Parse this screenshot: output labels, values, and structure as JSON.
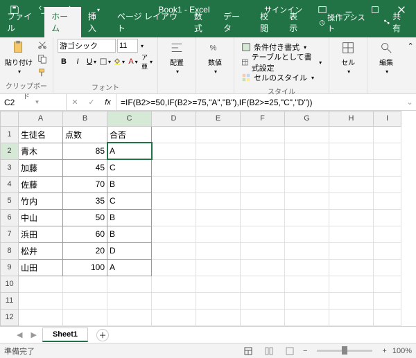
{
  "title": "Book1 - Excel",
  "signin": "サインイン",
  "tabs": {
    "file": "ファイル",
    "home": "ホーム",
    "insert": "挿入",
    "layout": "ページ レイアウト",
    "formulas": "数式",
    "data": "データ",
    "review": "校閲",
    "view": "表示",
    "tell": "操作アシスト",
    "share": "共有"
  },
  "ribbon": {
    "clipboard": {
      "label": "クリップボード",
      "paste": "貼り付け"
    },
    "font": {
      "label": "フォント",
      "name": "游ゴシック",
      "size": "11"
    },
    "align": {
      "label": "配置",
      "btn": "配置"
    },
    "number": {
      "label": "数値",
      "btn": "数値"
    },
    "styles": {
      "label": "スタイル",
      "cond": "条件付き書式",
      "table": "テーブルとして書式設定",
      "cell": "セルのスタイル"
    },
    "cells": {
      "label": "セル",
      "btn": "セル"
    },
    "editing": {
      "label": "編集",
      "btn": "編集"
    }
  },
  "namebox": "C2",
  "formula": "=IF(B2>=50,IF(B2>=75,\"A\",\"B\"),IF(B2>=25,\"C\",\"D\"))",
  "cols": [
    "A",
    "B",
    "C",
    "D",
    "E",
    "F",
    "G",
    "H",
    "I"
  ],
  "rows": [
    "1",
    "2",
    "3",
    "4",
    "5",
    "6",
    "7",
    "8",
    "9",
    "10",
    "11",
    "12"
  ],
  "headers": {
    "a": "生徒名",
    "b": "点数",
    "c": "合否"
  },
  "data": [
    {
      "a": "青木",
      "b": "85",
      "c": "A"
    },
    {
      "a": "加藤",
      "b": "45",
      "c": "C"
    },
    {
      "a": "佐藤",
      "b": "70",
      "c": "B"
    },
    {
      "a": "竹内",
      "b": "35",
      "c": "C"
    },
    {
      "a": "中山",
      "b": "50",
      "c": "B"
    },
    {
      "a": "浜田",
      "b": "60",
      "c": "B"
    },
    {
      "a": "松井",
      "b": "20",
      "c": "D"
    },
    {
      "a": "山田",
      "b": "100",
      "c": "A"
    }
  ],
  "sheet": "Sheet1",
  "status": "準備完了",
  "zoom": "100%"
}
